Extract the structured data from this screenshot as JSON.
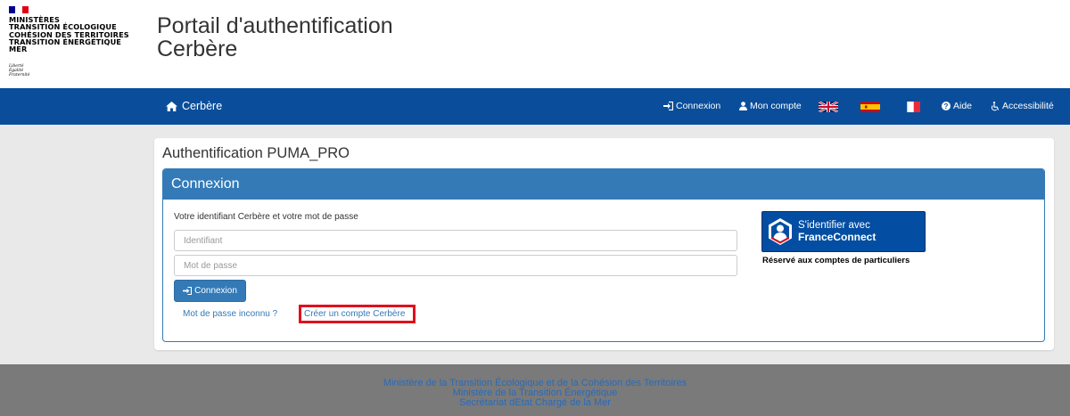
{
  "header": {
    "ministry_lines": [
      "MINISTÈRES",
      "TRANSITION ÉCOLOGIQUE",
      "COHÉSION DES TERRITOIRES",
      "TRANSITION ÉNERGÉTIQUE",
      "MER"
    ],
    "motto": [
      "Liberté",
      "Égalité",
      "Fraternité"
    ],
    "title_line1": "Portail d'authentification",
    "title_line2": "Cerbère"
  },
  "navbar": {
    "brand": "Cerbère",
    "connexion": "Connexion",
    "mon_compte": "Mon compte",
    "aide": "Aide",
    "accessibilite": "Accessibilité",
    "flags": [
      "english-flag",
      "spanish-flag",
      "french-flag"
    ]
  },
  "main": {
    "auth_title": "Authentification PUMA_PRO",
    "panel_heading": "Connexion",
    "intro": "Votre identifiant Cerbère et votre mot de passe",
    "identifiant_placeholder": "Identifiant",
    "password_placeholder": "Mot de passe",
    "connexion_button": "Connexion",
    "forgot_password_link": "Mot de passe inconnu ?",
    "create_account_link": "Créer un compte Cerbère",
    "franceconnect_line1": "S'identifier avec",
    "franceconnect_line2": "FranceConnect",
    "franceconnect_note": "Réservé aux comptes de particuliers"
  },
  "footer": {
    "lines": [
      "Ministère de la Transition Écologique et de la Cohésion des Territoires",
      "Ministère de la Transition Énergétique",
      "Secrétariat dEtat Chargé de la Mer"
    ]
  },
  "colors": {
    "navbar": "#0a4e9b",
    "panel_primary": "#337ab7",
    "highlight": "#e0101e",
    "footer_bg": "#7a7a7a",
    "franceconnect": "#034ea2"
  }
}
